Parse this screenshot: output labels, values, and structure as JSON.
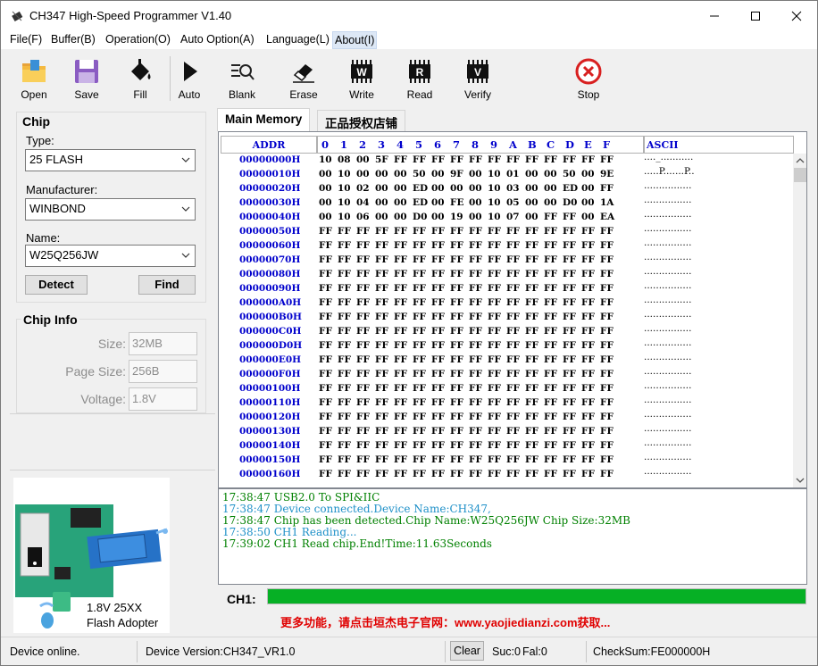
{
  "window": {
    "title": "CH347 High-Speed Programmer  V1.40",
    "minimize": "—",
    "maximize": "☐",
    "close": "✕"
  },
  "menu": [
    {
      "label": "File(F)"
    },
    {
      "label": "Buffer(B)"
    },
    {
      "label": "Operation(O)"
    },
    {
      "label": "Auto Option(A)"
    },
    {
      "label": "Language(L)"
    },
    {
      "label": "About(I)"
    }
  ],
  "toolbar": [
    {
      "label": "Open",
      "icon": "folder-icon"
    },
    {
      "label": "Save",
      "icon": "floppy-icon"
    },
    {
      "label": "Fill",
      "icon": "paint-bucket-icon"
    },
    {
      "label": "Auto",
      "icon": "play-icon"
    },
    {
      "label": "Blank",
      "icon": "blank-check-icon"
    },
    {
      "label": "Erase",
      "icon": "eraser-icon"
    },
    {
      "label": "Write",
      "icon": "chip-write-icon"
    },
    {
      "label": "Read",
      "icon": "chip-read-icon"
    },
    {
      "label": "Verify",
      "icon": "chip-verify-icon"
    },
    {
      "label": "Stop",
      "icon": "stop-icon"
    }
  ],
  "chip": {
    "group_title": "Chip",
    "type_label": "Type:",
    "type_value": "25 FLASH",
    "manufacturer_label": "Manufacturer:",
    "manufacturer_value": "WINBOND",
    "name_label": "Name:",
    "name_value": "W25Q256JW",
    "detect_label": "Detect",
    "find_label": "Find"
  },
  "chip_info": {
    "group_title": "Chip Info",
    "size_label": "Size:",
    "size_value": "32MB",
    "page_label": "Page Size:",
    "page_value": "256B",
    "voltage_label": "Voltage:",
    "voltage_value": "1.8V"
  },
  "adapter": {
    "caption_line1": "1.8V 25XX",
    "caption_line2": "Flash Adopter"
  },
  "tabs": [
    {
      "label": "Main Memory"
    },
    {
      "label": "正品授权店铺"
    }
  ],
  "hex": {
    "addr_header": "ADDR",
    "ascii_header": "ASCII",
    "columns": [
      "0",
      "1",
      "2",
      "3",
      "4",
      "5",
      "6",
      "7",
      "8",
      "9",
      "A",
      "B",
      "C",
      "D",
      "E",
      "F"
    ],
    "rows": [
      {
        "addr": "00000000H",
        "bytes": "10 08 00 5F FF FF FF FF FF FF FF FF FF FF FF FF",
        "ascii": "...._..........."
      },
      {
        "addr": "00000010H",
        "bytes": "00 10 00 00 00 50 00 9F 00 10 01 00 00 50 00 9E",
        "ascii": ".....P.......P.."
      },
      {
        "addr": "00000020H",
        "bytes": "00 10 02 00 00 ED 00 00 00 10 03 00 00 ED 00 FF",
        "ascii": "................"
      },
      {
        "addr": "00000030H",
        "bytes": "00 10 04 00 00 ED 00 FE 00 10 05 00 00 D0 00 1A",
        "ascii": "................"
      },
      {
        "addr": "00000040H",
        "bytes": "00 10 06 00 00 D0 00 19 00 10 07 00 FF FF 00 EA",
        "ascii": "................"
      },
      {
        "addr": "00000050H",
        "bytes": "FF FF FF FF FF FF FF FF FF FF FF FF FF FF FF FF",
        "ascii": "................"
      },
      {
        "addr": "00000060H",
        "bytes": "FF FF FF FF FF FF FF FF FF FF FF FF FF FF FF FF",
        "ascii": "................"
      },
      {
        "addr": "00000070H",
        "bytes": "FF FF FF FF FF FF FF FF FF FF FF FF FF FF FF FF",
        "ascii": "................"
      },
      {
        "addr": "00000080H",
        "bytes": "FF FF FF FF FF FF FF FF FF FF FF FF FF FF FF FF",
        "ascii": "................"
      },
      {
        "addr": "00000090H",
        "bytes": "FF FF FF FF FF FF FF FF FF FF FF FF FF FF FF FF",
        "ascii": "................"
      },
      {
        "addr": "000000A0H",
        "bytes": "FF FF FF FF FF FF FF FF FF FF FF FF FF FF FF FF",
        "ascii": "................"
      },
      {
        "addr": "000000B0H",
        "bytes": "FF FF FF FF FF FF FF FF FF FF FF FF FF FF FF FF",
        "ascii": "................"
      },
      {
        "addr": "000000C0H",
        "bytes": "FF FF FF FF FF FF FF FF FF FF FF FF FF FF FF FF",
        "ascii": "................"
      },
      {
        "addr": "000000D0H",
        "bytes": "FF FF FF FF FF FF FF FF FF FF FF FF FF FF FF FF",
        "ascii": "................"
      },
      {
        "addr": "000000E0H",
        "bytes": "FF FF FF FF FF FF FF FF FF FF FF FF FF FF FF FF",
        "ascii": "................"
      },
      {
        "addr": "000000F0H",
        "bytes": "FF FF FF FF FF FF FF FF FF FF FF FF FF FF FF FF",
        "ascii": "................"
      },
      {
        "addr": "00000100H",
        "bytes": "FF FF FF FF FF FF FF FF FF FF FF FF FF FF FF FF",
        "ascii": "................"
      },
      {
        "addr": "00000110H",
        "bytes": "FF FF FF FF FF FF FF FF FF FF FF FF FF FF FF FF",
        "ascii": "................"
      },
      {
        "addr": "00000120H",
        "bytes": "FF FF FF FF FF FF FF FF FF FF FF FF FF FF FF FF",
        "ascii": "................"
      },
      {
        "addr": "00000130H",
        "bytes": "FF FF FF FF FF FF FF FF FF FF FF FF FF FF FF FF",
        "ascii": "................"
      },
      {
        "addr": "00000140H",
        "bytes": "FF FF FF FF FF FF FF FF FF FF FF FF FF FF FF FF",
        "ascii": "................"
      },
      {
        "addr": "00000150H",
        "bytes": "FF FF FF FF FF FF FF FF FF FF FF FF FF FF FF FF",
        "ascii": "................"
      },
      {
        "addr": "00000160H",
        "bytes": "FF FF FF FF FF FF FF FF FF FF FF FF FF FF FF FF",
        "ascii": "................"
      }
    ]
  },
  "log": [
    {
      "text": "17:38:47 USB2.0 To SPI&IIC",
      "color": "#008000"
    },
    {
      "text": "17:38:47 Device connected.Device Name:CH347,",
      "color": "#1e90c8"
    },
    {
      "text": "17:38:47 Chip has been detected.Chip Name:W25Q256JW Chip Size:32MB",
      "color": "#008000"
    },
    {
      "text": "17:38:50 CH1 Reading...",
      "color": "#1e90c8"
    },
    {
      "text": "17:39:02 CH1 Read chip.End!Time:11.63Seconds",
      "color": "#008000"
    }
  ],
  "progress": {
    "label": "CH1:",
    "fraction": 1.0,
    "color": "#06b025"
  },
  "promo": "更多功能，请点击垣杰电子官网：www.yaojiedianzi.com获取...",
  "status": {
    "device": "Device online.",
    "version": "Device Version:CH347_VR1.0",
    "clear": "Clear",
    "suc": "Suc:0",
    "fal": "Fal:0",
    "checksum": "CheckSum:FE000000H"
  }
}
